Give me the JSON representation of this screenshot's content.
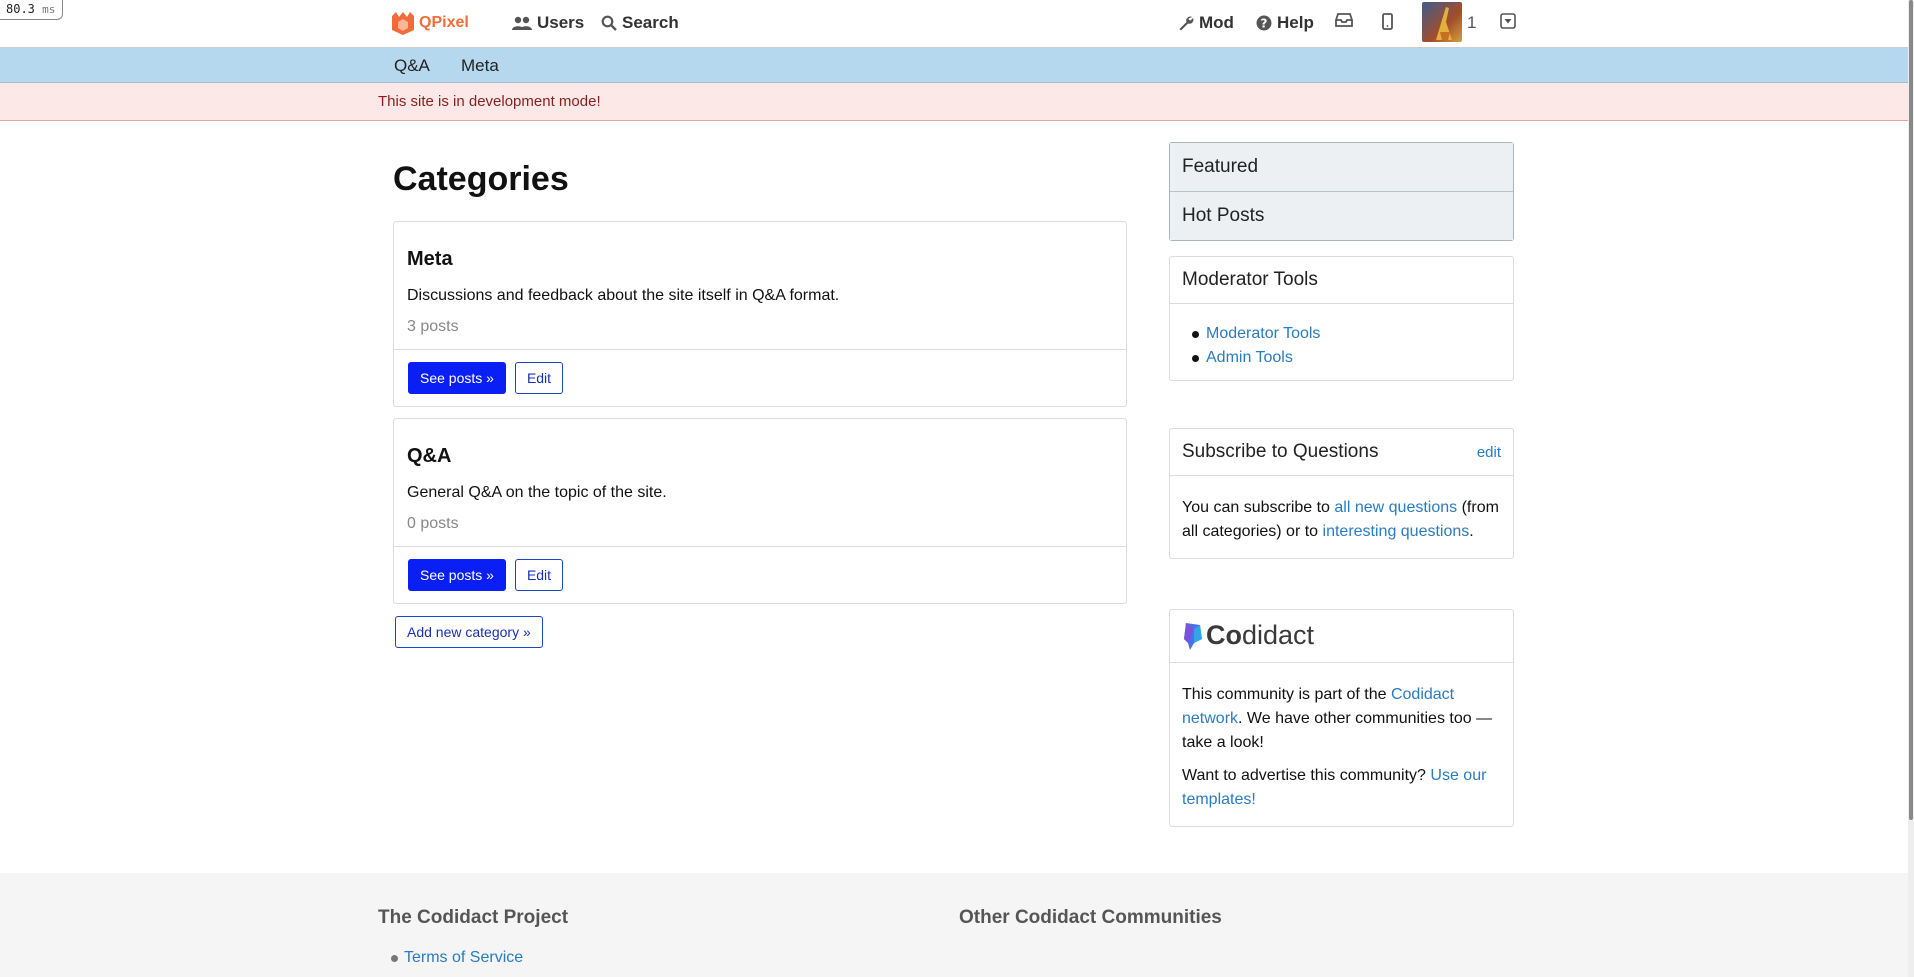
{
  "perf": {
    "value": "80.3",
    "unit": "ms"
  },
  "header": {
    "logo_text": "QPixel",
    "nav": {
      "users": "Users",
      "search": "Search",
      "mod": "Mod",
      "help": "Help"
    },
    "reputation": "1"
  },
  "category_tabs": [
    "Q&A",
    "Meta"
  ],
  "dev_notice": "This site is in development mode!",
  "main": {
    "title": "Categories",
    "categories": [
      {
        "name": "Meta",
        "description": "Discussions and feedback about the site itself in Q&A format.",
        "count": "3 posts",
        "see_posts": "See posts »",
        "edit": "Edit"
      },
      {
        "name": "Q&A",
        "description": "General Q&A on the topic of the site.",
        "count": "0 posts",
        "see_posts": "See posts »",
        "edit": "Edit"
      }
    ],
    "add_category": "Add new category »"
  },
  "sidebar": {
    "featured": "Featured",
    "hot_posts": "Hot Posts",
    "mod_tools": {
      "title": "Moderator Tools",
      "links": [
        "Moderator Tools",
        "Admin Tools"
      ]
    },
    "subscribe": {
      "title": "Subscribe to Questions",
      "edit": "edit",
      "text1": "You can subscribe to ",
      "link1": "all new questions",
      "text2": " (from all categories) or to ",
      "link2": "interesting questions",
      "text3": "."
    },
    "codidact": {
      "logo_text_co": "Co",
      "logo_text_rest": "didact",
      "p1_a": "This community is part of the ",
      "p1_link": "Codidact network",
      "p1_b": ". We have other communities too — take a look!",
      "p2_a": "Want to advertise this community? ",
      "p2_link": "Use our templates!"
    }
  },
  "footer": {
    "col1_title": "The Codidact Project",
    "col2_title": "Other Codidact Communities",
    "links": [
      "Terms of Service"
    ]
  },
  "colors": {
    "brand": "#f26b3a",
    "primary_button": "#0a1ff5",
    "category_bar": "#b6d8ee",
    "dev_notice_bg": "#fde8e8",
    "link": "#2a7bbf"
  }
}
